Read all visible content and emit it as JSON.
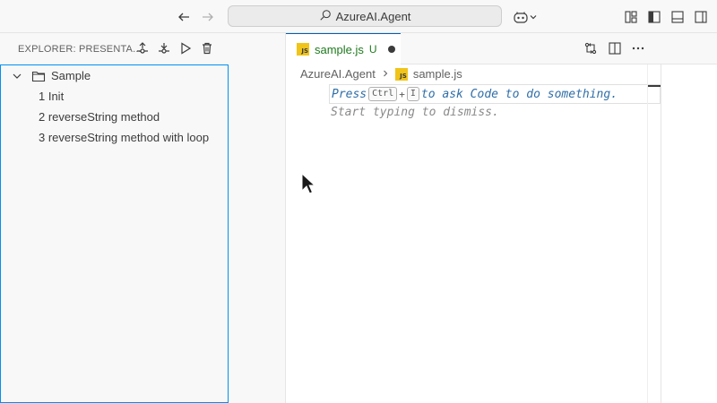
{
  "titlebar": {
    "search_text": "AzureAI.Agent",
    "icons": [
      "back-arrow-icon",
      "forward-arrow-icon",
      "search-icon",
      "copilot-icon",
      "chevron-down-icon",
      "customize-layout-icon",
      "toggle-primary-sidebar-icon",
      "toggle-panel-icon",
      "toggle-secondary-sidebar-icon"
    ]
  },
  "sidebar": {
    "title": "EXPLORER: PRESENTA...",
    "actions": [
      "previous-icon",
      "next-icon",
      "run-icon",
      "trash-icon"
    ],
    "root": {
      "label": "Sample",
      "expanded": true
    },
    "items": [
      {
        "label": "1 Init"
      },
      {
        "label": "2 reverseString method"
      },
      {
        "label": "3 reverseString method with loop"
      }
    ]
  },
  "editor": {
    "tab": {
      "badge": "JS",
      "name": "sample.js",
      "status": "U"
    },
    "breadcrumb": {
      "folder": "AzureAI.Agent",
      "file": "sample.js"
    },
    "hint": {
      "press": "Press",
      "key1": "Ctrl",
      "plus": "+",
      "key2": "I",
      "rest": "to ask Code to do something.",
      "line2": "Start typing to dismiss."
    },
    "actions": [
      "compare-changes-icon",
      "split-editor-icon",
      "more-actions-icon"
    ]
  },
  "colors": {
    "accent": "#005fb8",
    "focus_border": "#0090f1",
    "untracked_green": "#1f7a1f",
    "js_yellow": "#f0c419",
    "hint_blue": "#2f6ea8"
  }
}
